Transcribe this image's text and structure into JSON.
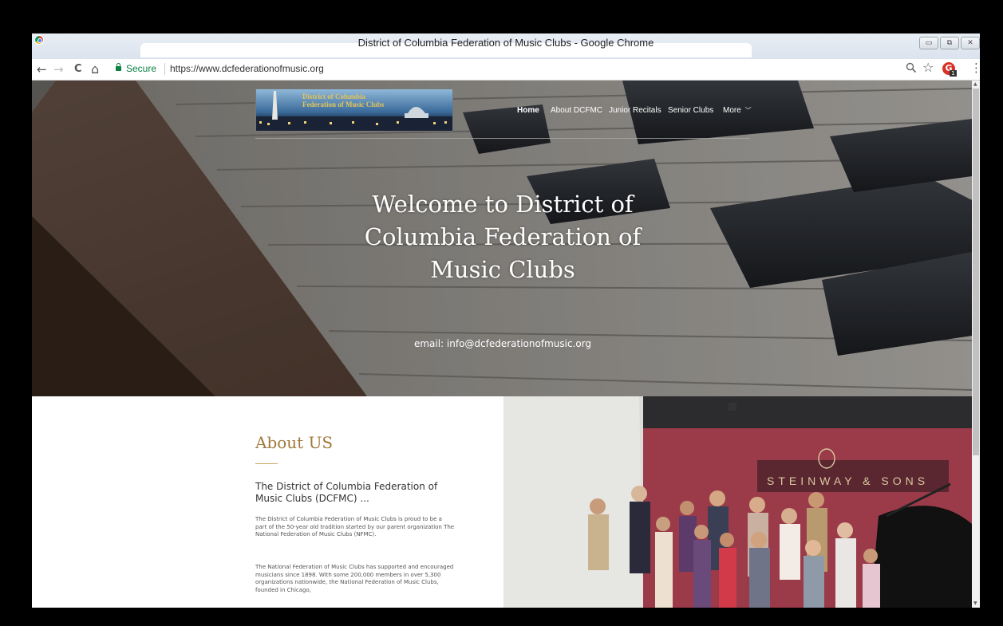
{
  "window": {
    "title": "District of Columbia Federation of Music Clubs - Google Chrome",
    "controls": [
      "▭",
      "⧉",
      "✕"
    ]
  },
  "toolbar": {
    "back": "←",
    "forward": "→",
    "reload": "C",
    "home": "⌂",
    "secure_label": "Secure",
    "url": "https://www.dcfederationofmusic.org",
    "zoom_icon": "zoom-icon",
    "star_icon": "bookmark-star-icon",
    "extension_letter": "G",
    "extension_badge": "1",
    "menu_icon": "⋮"
  },
  "site": {
    "logo_line1": "District of Columbia",
    "logo_line2": "Federation of Music Clubs",
    "nav": {
      "home": "Home",
      "about": "About DCFMC",
      "junior": "Junior Recitals",
      "senior": "Senior Clubs",
      "more": "More"
    },
    "hero_title": "Welcome to District of Columbia Federation of Music Clubs",
    "hero_email": "email: info@dcfederationofmusic.org",
    "about": {
      "heading": "About US",
      "subheading": "The District of Columbia Federation of Music Clubs (DCFMC) ...",
      "para1": "The District of Columbia Federation of Music Clubs is proud to be a part of the 50-year old tradition started by our parent organization The National Federation of Music Clubs (NFMC).",
      "para2": "The National Federation of Music Clubs has supported and encouraged musicians since 1898.  With some 200,000 members in over 5,300 organizations nationwide, the National Federation of Music Clubs, founded in Chicago,"
    },
    "photo_sign": "STEINWAY & SONS"
  },
  "colors": {
    "accent_gold": "#a0793a",
    "secure_green": "#0b8043"
  }
}
